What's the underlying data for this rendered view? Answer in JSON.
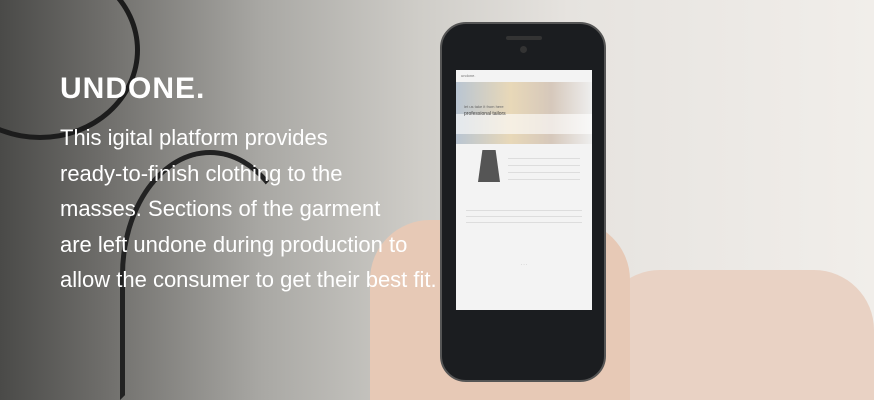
{
  "headline": "UNDONE.",
  "body_lines": [
    "This igital platform provides",
    "ready-to-finish clothing to the",
    "masses. Sections of the garment",
    "are left undone during production to",
    "allow the consumer to get their best fit."
  ],
  "phone_screen": {
    "logo": "undone.",
    "hero_line1": "let us take it from here",
    "hero_line2": "professional tailors"
  },
  "colors": {
    "text": "#ffffff",
    "phone": "#1b1d20"
  }
}
